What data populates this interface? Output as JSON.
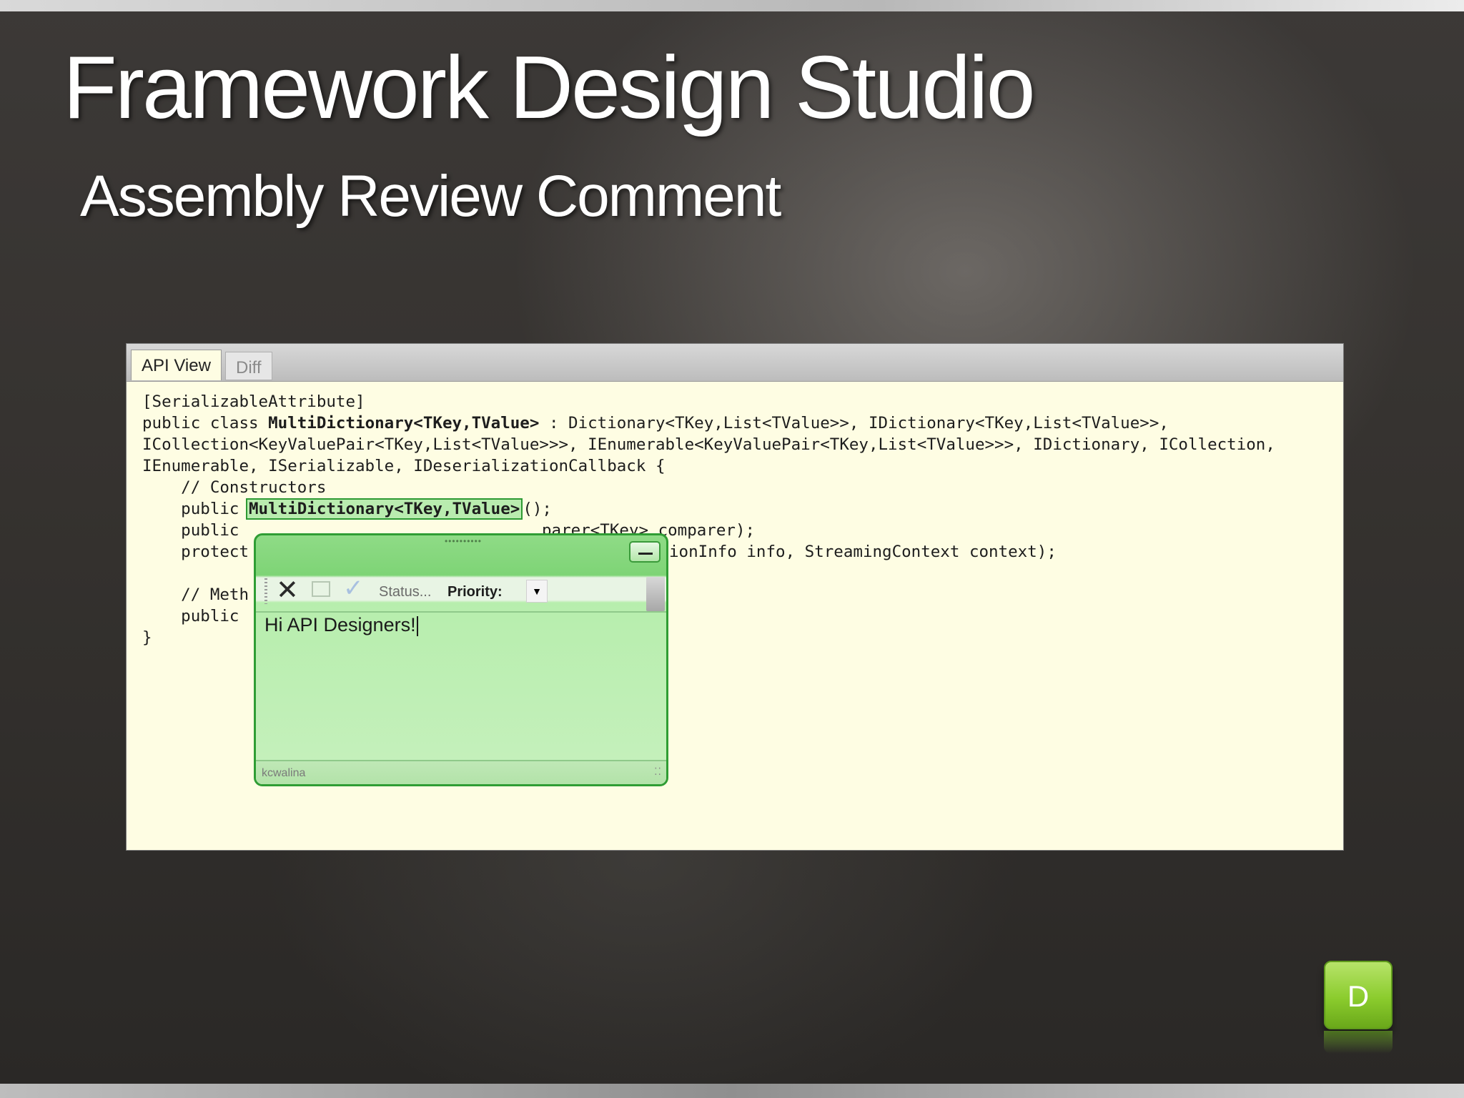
{
  "slide": {
    "title": "Framework Design Studio",
    "subtitle": "Assembly Review Comment",
    "badge": "D"
  },
  "tabs": [
    {
      "label": "API View",
      "active": true
    },
    {
      "label": "Diff",
      "active": false
    }
  ],
  "code": {
    "attribute": "[SerializableAttribute]",
    "class_decl_prefix": "public class ",
    "class_name": "MultiDictionary<TKey,TValue>",
    "class_decl_suffix": " : Dictionary<TKey,List<TValue>>, IDictionary<TKey,List<TValue>>,",
    "line_3": "ICollection<KeyValuePair<TKey,List<TValue>>>, IEnumerable<KeyValuePair<TKey,List<TValue>>>, IDictionary, ICollection,",
    "line_4": "IEnumerable, ISerializable, IDeserializationCallback {",
    "comment_constructors": "    // Constructors",
    "ctor1_prefix": "    public ",
    "ctor1_name": "MultiDictionary<TKey,TValue>",
    "ctor1_suffix": "();",
    "ctor2_left": "    public ",
    "ctor2_right": "parer<TKey> comparer);",
    "ctor3_left": "    protect",
    "ctor3_right": "ionInfo info, StreamingContext context);",
    "comment_methods_left": "    // Meth",
    "method_left": "    public ",
    "closing_brace": "}"
  },
  "comment_popup": {
    "status_label": "Status...",
    "priority_label": "Priority:",
    "text": "Hi API Designers!",
    "author": "kcwalina",
    "icons": [
      "delete-icon",
      "edit-icon",
      "check-icon",
      "minimize-icon",
      "dropdown-arrow-icon"
    ]
  },
  "colors": {
    "code_background": "#fefde3",
    "comment_green": "#2f9d34",
    "badge_green": "#8bcc2d"
  }
}
